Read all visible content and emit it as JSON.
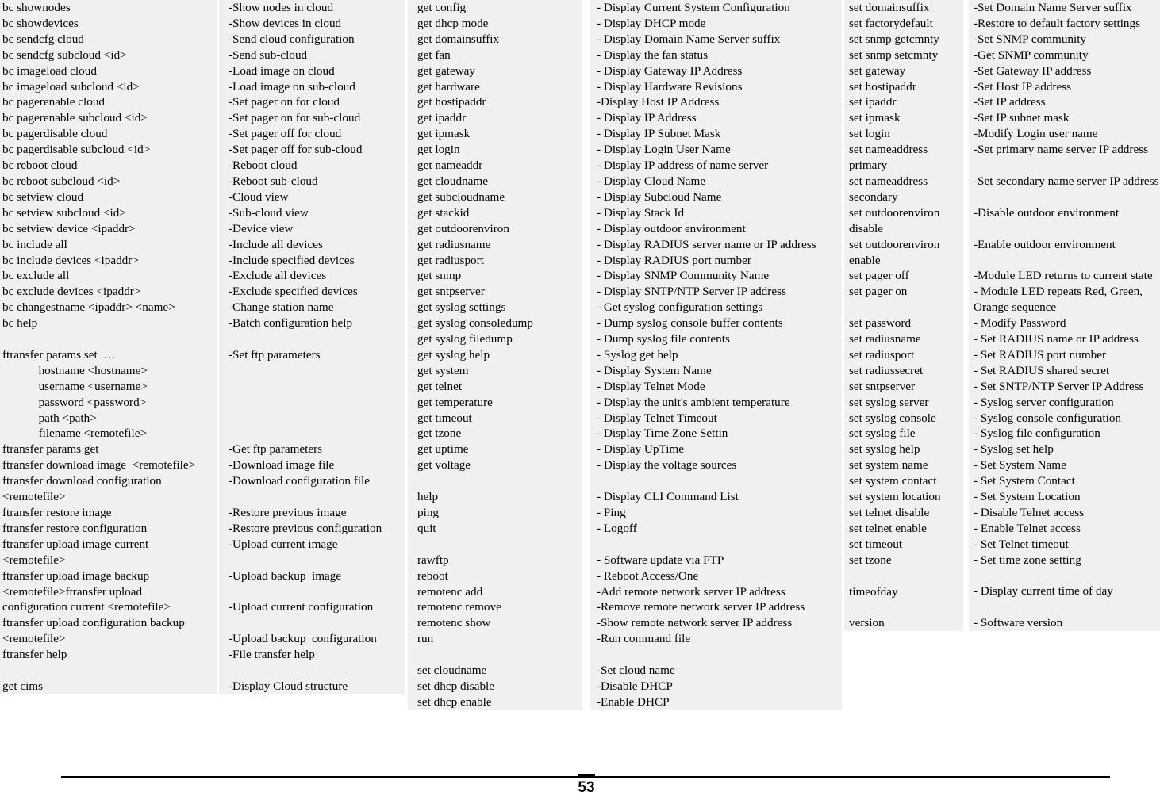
{
  "document": {
    "page_number": "53",
    "type": "cli-command-reference-table"
  },
  "columns": [
    {
      "name": "command-column-1",
      "lines": [
        "bc shownodes",
        "bc showdevices",
        "bc sendcfg cloud",
        "bc sendcfg subcloud <id>",
        "bc imageload cloud",
        "bc imageload subcloud <id>",
        "bc pagerenable cloud",
        "bc pagerenable subcloud <id>",
        "bc pagerdisable cloud",
        "bc pagerdisable subcloud <id>",
        "bc reboot cloud",
        "bc reboot subcloud <id>",
        "bc setview cloud",
        "bc setview subcloud <id>",
        "bc setview device <ipaddr>",
        "bc include all",
        "bc include devices <ipaddr>",
        "bc exclude all",
        "bc exclude devices <ipaddr>",
        "bc changestname <ipaddr> <name>",
        "bc help",
        "",
        "ftransfer params set  …",
        "            hostname <hostname>",
        "            username <username>",
        "            password <password>",
        "            path <path>",
        "            filename <remotefile>",
        "ftransfer params get",
        "ftransfer download image  <remotefile>",
        "ftransfer download configuration",
        "<remotefile>",
        "ftransfer restore image",
        "ftransfer restore configuration",
        "ftransfer upload image current",
        "<remotefile>",
        "ftransfer upload image backup",
        "<remotefile>ftransfer upload",
        "configuration current <remotefile>",
        "ftransfer upload configuration backup",
        "<remotefile>",
        "ftransfer help",
        "",
        "get cims"
      ]
    },
    {
      "name": "description-column-2",
      "lines": [
        "-Show nodes in cloud",
        "-Show devices in cloud",
        "-Send cloud configuration",
        "-Send sub-cloud",
        "-Load image on cloud",
        "-Load image on sub-cloud",
        "-Set pager on for cloud",
        "-Set pager on for sub-cloud",
        "-Set pager off for cloud",
        "-Set pager off for sub-cloud",
        "-Reboot cloud",
        "-Reboot sub-cloud",
        "-Cloud view",
        "-Sub-cloud view",
        "-Device view",
        "-Include all devices",
        "-Include specified devices",
        "-Exclude all devices",
        "-Exclude specified devices",
        "-Change station name",
        "-Batch configuration help",
        "",
        "-Set ftp parameters",
        "",
        "",
        "",
        "",
        "",
        "-Get ftp parameters",
        "-Download image file",
        "-Download configuration file",
        "",
        "-Restore previous image",
        "-Restore previous configuration",
        "-Upload current image",
        "",
        "-Upload backup  image",
        "",
        "-Upload current configuration",
        "",
        "-Upload backup  configuration",
        "-File transfer help",
        "",
        "-Display Cloud structure"
      ]
    },
    {
      "name": "command-column-3",
      "lines": [
        "get config",
        "get dhcp mode",
        "get domainsuffix",
        "get fan",
        "get gateway",
        "get hardware",
        "get hostipaddr",
        "get ipaddr",
        "get ipmask",
        "get login",
        "get nameaddr",
        "get cloudname",
        "get subcloudname",
        "get stackid",
        "get outdoorenviron",
        "get radiusname",
        "get radiusport",
        "get snmp",
        "get sntpserver",
        "get syslog settings",
        "get syslog consoledump",
        "get syslog filedump",
        "get syslog help",
        "get system",
        "get telnet",
        "get temperature",
        "get timeout",
        "get tzone",
        "get uptime",
        "get voltage",
        "",
        "help",
        "ping",
        "quit",
        "",
        "rawftp",
        "reboot",
        "remotenc add",
        "remotenc remove",
        "remotenc show",
        "run",
        "",
        "set cloudname",
        "set dhcp disable",
        "set dhcp enable"
      ]
    },
    {
      "name": "description-column-4",
      "lines": [
        "- Display Current System Configuration",
        "- Display DHCP mode",
        "- Display Domain Name Server suffix",
        "- Display the fan status",
        "- Display Gateway IP Address",
        "- Display Hardware Revisions",
        "-Display Host IP Address",
        "- Display IP Address",
        "- Display IP Subnet Mask",
        "- Display Login User Name",
        "- Display IP address of name server",
        "- Display Cloud Name",
        "- Display Subcloud Name",
        "- Display Stack Id",
        "- Display outdoor environment",
        "- Display RADIUS server name or IP address",
        "- Display RADIUS port number",
        "- Display SNMP Community Name",
        "- Display SNTP/NTP Server IP address",
        "- Get syslog configuration settings",
        "- Dump syslog console buffer contents",
        "- Dump syslog file contents",
        "- Syslog get help",
        "- Display System Name",
        "- Display Telnet Mode",
        "- Display the unit's ambient temperature",
        "- Display Telnet Timeout",
        "- Display Time Zone Settin",
        "- Display UpTime",
        "- Display the voltage sources",
        "",
        "- Display CLI Command List",
        "- Ping",
        "- Logoff",
        "",
        "- Software update via FTP",
        "- Reboot Access/One",
        "-Add remote network server IP address",
        "-Remove remote network server IP address",
        "-Show remote network server IP address",
        "-Run command file",
        "",
        "-Set cloud name",
        "-Disable DHCP",
        "-Enable DHCP"
      ]
    },
    {
      "name": "command-column-5",
      "lines": [
        "set domainsuffix",
        "set factorydefault",
        "set snmp getcmnty",
        "set snmp setcmnty",
        "set gateway",
        "set hostipaddr",
        "set ipaddr",
        "set ipmask",
        "set login",
        "set nameaddress",
        "primary",
        "set nameaddress",
        "secondary",
        "set outdoorenviron",
        "disable",
        "set outdoorenviron",
        "enable",
        "set pager off",
        "set pager on",
        "",
        "set password",
        "set radiusname",
        "set radiusport",
        "set radiussecret",
        "set sntpserver",
        "set syslog server",
        "set syslog console",
        "set syslog file",
        "set syslog help",
        "set system name",
        "set system contact",
        "set system location",
        "set telnet disable",
        "set telnet enable",
        "set timeout",
        "set tzone",
        "",
        "timeofday",
        "",
        "version"
      ]
    },
    {
      "name": "description-column-6",
      "lines": [
        "-Set Domain Name Server suffix",
        "-Restore to default factory settings",
        "-Set SNMP community",
        "-Get SNMP community",
        "-Set Gateway IP address",
        "-Set Host IP address",
        "-Set IP address",
        "-Set IP subnet mask",
        "-Modify Login user name",
        "-Set primary name server IP address",
        "",
        "-Set secondary name server IP address",
        "",
        "-Disable outdoor environment",
        "",
        "-Enable outdoor environment",
        "",
        "-Module LED returns to current state",
        "- Module LED repeats Red, Green,",
        "Orange sequence",
        "- Modify Password",
        "- Set RADIUS name or IP address",
        "- Set RADIUS port number",
        "- Set RADIUS shared secret",
        "- Set SNTP/NTP Server IP Address",
        "- Syslog server configuration",
        "- Syslog console configuration",
        "- Syslog file configuration",
        "- Syslog set help",
        "- Set System Name",
        "- Set System Contact",
        "- Set System Location",
        "- Disable Telnet access",
        "- Enable Telnet access",
        "- Set Telnet timeout",
        "- Set time zone setting",
        "",
        "- Display current time of day",
        "",
        "- Software version"
      ]
    }
  ]
}
